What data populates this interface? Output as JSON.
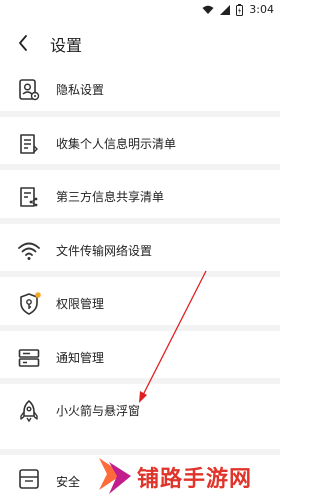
{
  "status_bar": {
    "time": "3:04",
    "icons": [
      "wifi-icon",
      "signal-icon",
      "battery-icon"
    ]
  },
  "header": {
    "title": "设置",
    "back_icon": "chevron-left-icon"
  },
  "items": [
    {
      "label": "隐私设置",
      "icon": "privacy-settings-icon"
    },
    {
      "label": "收集个人信息明示清单",
      "icon": "document-list-icon"
    },
    {
      "label": "第三方信息共享清单",
      "icon": "share-list-icon"
    },
    {
      "label": "文件传输网络设置",
      "icon": "wifi-settings-icon"
    },
    {
      "label": "权限管理",
      "icon": "permission-shield-icon",
      "badge_color": "#f5a623"
    },
    {
      "label": "通知管理",
      "icon": "notification-icon"
    },
    {
      "label": "小火箭与悬浮窗",
      "icon": "rocket-icon"
    }
  ],
  "bottom_item": {
    "label": "安全",
    "icon": "security-icon"
  },
  "watermark": {
    "text": "铺路手游网",
    "logo": "watermark-logo-icon",
    "color": "#e0342a"
  },
  "annotation": {
    "arrow_color": "#e02020"
  }
}
